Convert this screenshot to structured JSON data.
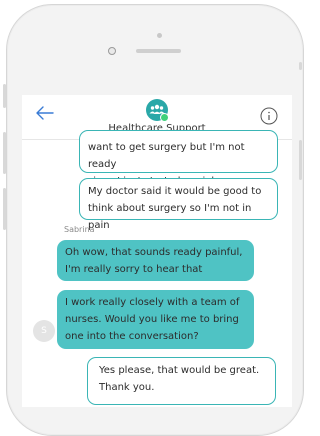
{
  "header": {
    "title": "Healthcare Support"
  },
  "messages": [
    {
      "from": "user",
      "lines": [
        "want to get surgery but I'm not ready",
        "since I just started my job"
      ]
    },
    {
      "from": "user",
      "lines": [
        "My doctor said it would be good to",
        "think about surgery so I'm not in pain"
      ]
    },
    {
      "from": "agent",
      "lines": [
        "Oh wow, that sounds ready painful,",
        "I'm really sorry to hear that"
      ]
    },
    {
      "from": "agent",
      "lines": [
        "I work really closely with a team of",
        "nurses. Would you like me to bring",
        "one into the conversation?"
      ]
    },
    {
      "from": "user",
      "lines": [
        "Yes please, that would be great.",
        "Thank you."
      ]
    }
  ],
  "sender_name": "Sabrina",
  "sender_initial": "S",
  "colors": {
    "accent": "#4fc3c4",
    "user_border": "#3ab5b5",
    "online": "#3fd17a"
  },
  "icons": {
    "back": "arrow-left-icon",
    "info": "info-icon",
    "avatar": "group-icon"
  }
}
